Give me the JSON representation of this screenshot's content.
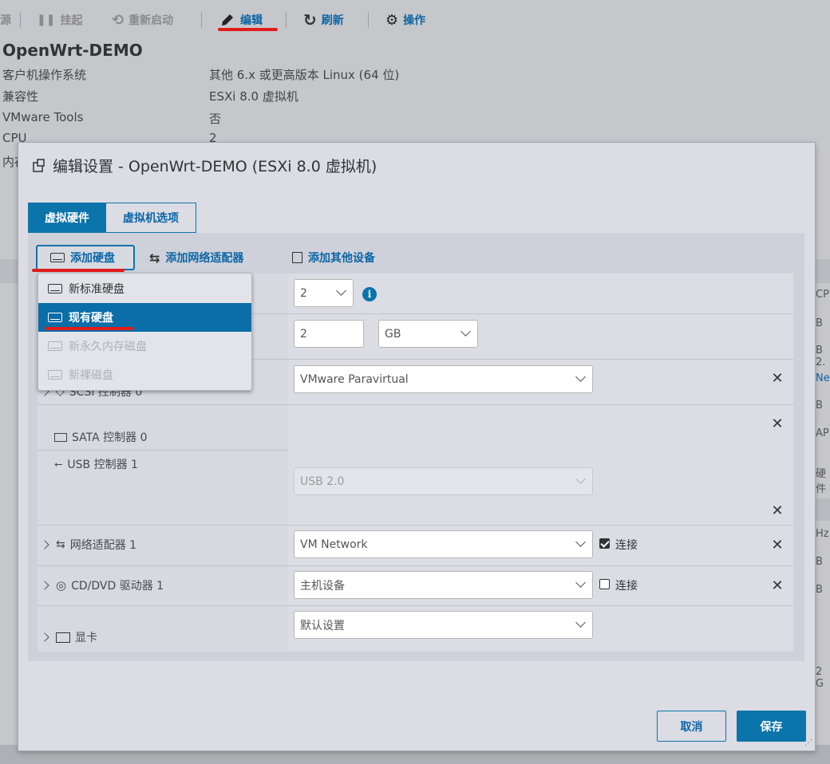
{
  "toolbar": {
    "partial_left": "源",
    "suspend": "挂起",
    "restart": "重新启动",
    "edit": "编辑",
    "refresh": "刷新",
    "actions": "操作"
  },
  "vm_summary": {
    "name": "OpenWrt-DEMO",
    "rows": [
      {
        "label": "客户机操作系统",
        "value": "其他 6.x 或更高版本 Linux (64 位)"
      },
      {
        "label": "兼容性",
        "value": "ESXi 8.0 虚拟机"
      },
      {
        "label": "VMware Tools",
        "value": "否"
      },
      {
        "label": "CPU",
        "value": "2"
      },
      {
        "label": "内存",
        "value": ""
      }
    ]
  },
  "side_fragments": [
    "CPU",
    "B",
    "B 2.",
    "Ne",
    "B",
    "API",
    "硬件",
    "Hz",
    "B",
    "B",
    "2 G"
  ],
  "dialog": {
    "title": "编辑设置 - OpenWrt-DEMO (ESXi 8.0 虚拟机)",
    "tabs": [
      {
        "label": "虚拟硬件",
        "active": true
      },
      {
        "label": "虚拟机选项",
        "active": false
      }
    ],
    "add_buttons": {
      "hard_disk": "添加硬盘",
      "network_adapter": "添加网络适配器",
      "other_device": "添加其他设备"
    },
    "add_disk_menu": [
      {
        "label": "新标准硬盘",
        "state": "normal"
      },
      {
        "label": "现有硬盘",
        "state": "selected"
      },
      {
        "label": "新永久内存磁盘",
        "state": "disabled"
      },
      {
        "label": "新裸磁盘",
        "state": "disabled"
      }
    ],
    "rows": {
      "cpu": {
        "value": "2"
      },
      "memory": {
        "value": "2",
        "unit": "GB"
      },
      "scsi": {
        "label": "SCSI 控制器 0",
        "value": "VMware Paravirtual"
      },
      "sata": {
        "label": "SATA 控制器 0"
      },
      "usb": {
        "label": "USB 控制器 1",
        "value": "USB 2.0"
      },
      "network": {
        "label": "网络适配器 1",
        "value": "VM Network",
        "connect_label": "连接",
        "connected": true
      },
      "cddvd": {
        "label": "CD/DVD 驱动器 1",
        "value": "主机设备",
        "connect_label": "连接",
        "connected": false
      },
      "video": {
        "label": "显卡",
        "value": "默认设置"
      }
    },
    "footer": {
      "cancel": "取消",
      "save": "保存"
    }
  },
  "colors": {
    "accent": "#0b74aa",
    "annotation_red": "#e21b1b"
  }
}
